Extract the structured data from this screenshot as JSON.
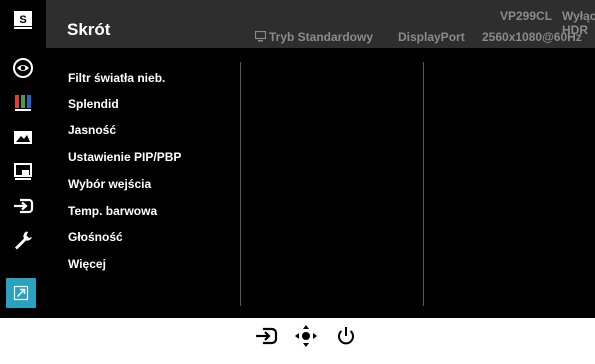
{
  "header": {
    "title": "Skrót",
    "model": "VP299CL",
    "hdr_status": "Wyłącz HDR",
    "mode": "Tryb Standardowy",
    "input": "DisplayPort",
    "resolution": "2560x1080@60Hz"
  },
  "sidebar": {
    "items": [
      {
        "icon": "shortcut-s-icon"
      },
      {
        "icon": "eye-icon"
      },
      {
        "icon": "color-bars-icon"
      },
      {
        "icon": "image-icon"
      },
      {
        "icon": "pip-icon"
      },
      {
        "icon": "input-icon"
      },
      {
        "icon": "wrench-icon"
      },
      {
        "icon": "shortcut-arrow-icon",
        "active": true
      }
    ],
    "active_color": "#2aa1bf"
  },
  "menu": {
    "items": [
      "Filtr światła nieb.",
      "Splendid",
      "Jasność",
      "Ustawienie PIP/PBP",
      "Wybór wejścia",
      "Temp. barwowa",
      "Głośność",
      "Więcej"
    ]
  },
  "bottom_buttons": [
    "input-icon",
    "navigation-joystick-icon",
    "power-icon"
  ]
}
